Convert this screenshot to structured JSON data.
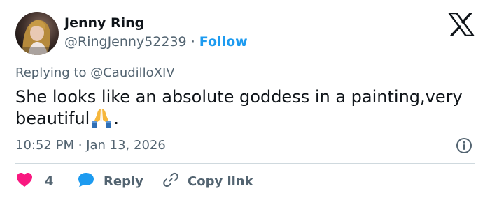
{
  "author": {
    "name": "Jenny Ring",
    "handle": "@RingJenny52239",
    "separator": "·",
    "follow_label": "Follow"
  },
  "reply_context": {
    "prefix": "Replying to",
    "mention": "@CaudilloXIV"
  },
  "tweet": {
    "text": "She looks like an absolute goddess in a painting,very beautiful",
    "emoji": "folded-hands-emoji",
    "trailing": ".",
    "time": "10:52 PM",
    "separator": "·",
    "date": "Jan 13, 2026"
  },
  "actions": {
    "like_count": "4",
    "reply_label": "Reply",
    "copy_label": "Copy link"
  },
  "icons": {
    "logo": "x-logo-icon",
    "info": "info-icon",
    "like": "heart-icon",
    "reply": "speech-bubble-icon",
    "copy": "link-icon"
  },
  "colors": {
    "accent": "#1d9bf0",
    "like": "#f91880",
    "muted": "#536471",
    "text": "#0f1419"
  }
}
